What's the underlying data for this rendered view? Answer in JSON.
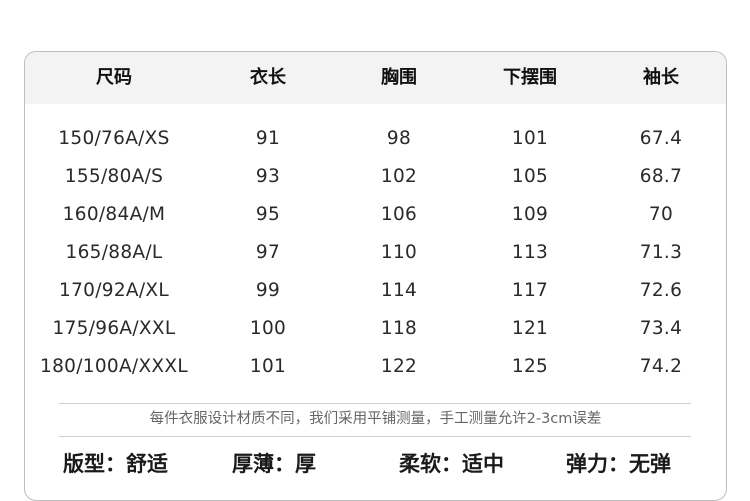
{
  "table": {
    "headers": [
      "尺码",
      "衣长",
      "胸围",
      "下摆围",
      "袖长"
    ],
    "rows": [
      [
        "150/76A/XS",
        "91",
        "98",
        "101",
        "67.4"
      ],
      [
        "155/80A/S",
        "93",
        "102",
        "105",
        "68.7"
      ],
      [
        "160/84A/M",
        "95",
        "106",
        "109",
        "70"
      ],
      [
        "165/88A/L",
        "97",
        "110",
        "113",
        "71.3"
      ],
      [
        "170/92A/XL",
        "99",
        "114",
        "117",
        "72.6"
      ],
      [
        "175/96A/XXL",
        "100",
        "118",
        "121",
        "73.4"
      ],
      [
        "180/100A/XXXL",
        "101",
        "122",
        "125",
        "74.2"
      ]
    ]
  },
  "note": "每件衣服设计材质不同，我们采用平铺测量，手工测量允许2-3cm误差",
  "properties": [
    "版型：舒适",
    "厚薄：厚",
    "柔软：适中",
    "弹力：无弹"
  ]
}
